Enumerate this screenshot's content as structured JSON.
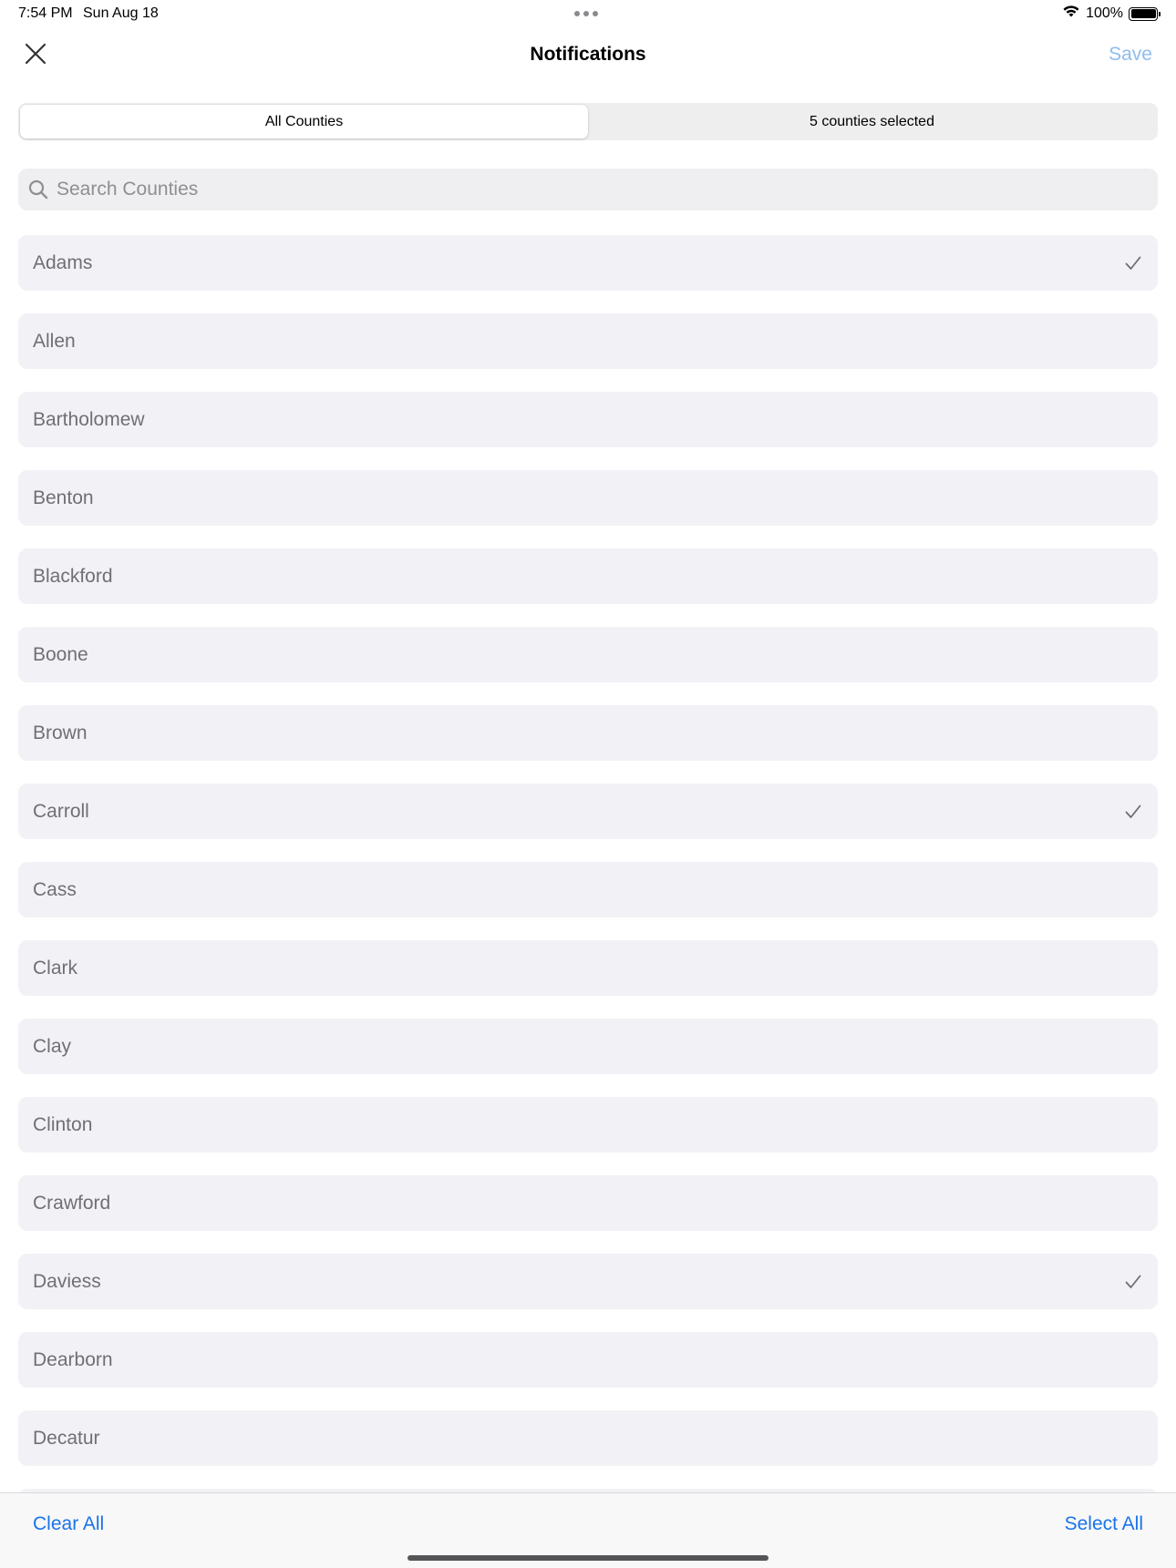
{
  "status_bar": {
    "time": "7:54 PM",
    "date": "Sun Aug 18",
    "battery": "100%"
  },
  "nav": {
    "title": "Notifications",
    "save_label": "Save",
    "close_icon": "close-icon"
  },
  "segments": [
    {
      "label": "All Counties",
      "active": true
    },
    {
      "label": "5 counties selected",
      "active": false
    }
  ],
  "search": {
    "placeholder": "Search Counties",
    "value": ""
  },
  "counties": [
    {
      "name": "Adams",
      "selected": true
    },
    {
      "name": "Allen",
      "selected": false
    },
    {
      "name": "Bartholomew",
      "selected": false
    },
    {
      "name": "Benton",
      "selected": false
    },
    {
      "name": "Blackford",
      "selected": false
    },
    {
      "name": "Boone",
      "selected": false
    },
    {
      "name": "Brown",
      "selected": false
    },
    {
      "name": "Carroll",
      "selected": true
    },
    {
      "name": "Cass",
      "selected": false
    },
    {
      "name": "Clark",
      "selected": false
    },
    {
      "name": "Clay",
      "selected": false
    },
    {
      "name": "Clinton",
      "selected": false
    },
    {
      "name": "Crawford",
      "selected": false
    },
    {
      "name": "Daviess",
      "selected": true
    },
    {
      "name": "Dearborn",
      "selected": false
    },
    {
      "name": "Decatur",
      "selected": false
    },
    {
      "name": "",
      "selected": false
    }
  ],
  "toolbar": {
    "clear_label": "Clear All",
    "select_label": "Select All"
  },
  "colors": {
    "accent": "#1a73e8",
    "save_disabled": "#8ebcf0",
    "row_background": "#f2f2f6",
    "row_text": "#707074"
  }
}
